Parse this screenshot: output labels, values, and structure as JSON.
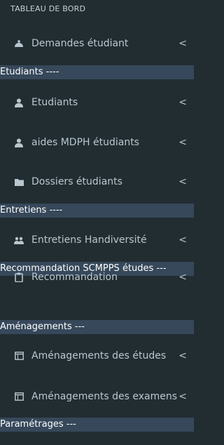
{
  "sidebar": {
    "header": "TABLEAU DE BORD",
    "items": [
      {
        "label": "Demandes étudiant",
        "icon": "dashboard-icon"
      },
      {
        "label": "Etudiants",
        "icon": "user-icon"
      },
      {
        "label": "aides MDPH étudiants",
        "icon": "user-icon"
      },
      {
        "label": "Dossiers étudiants",
        "icon": "folder-icon"
      },
      {
        "label": "Entretiens Handiversité",
        "icon": "users-icon"
      },
      {
        "label": "Recommandation",
        "icon": "clipboard-icon"
      },
      {
        "label": "Aménagements des études",
        "icon": "calendar-icon"
      },
      {
        "label": "Aménagements des examens",
        "icon": "calendar-icon"
      }
    ],
    "sections": [
      "Etudiants ----",
      "Entretiens ----",
      "Recommandation SCMPPS études ---",
      "Aménagements ---",
      "Paramétrages ---"
    ],
    "chevron": "<"
  },
  "colors": {
    "sidebar_bg": "#222d32",
    "section_bg": "#36485a",
    "text": "#b8c7ce",
    "section_text": "#ffffff"
  }
}
